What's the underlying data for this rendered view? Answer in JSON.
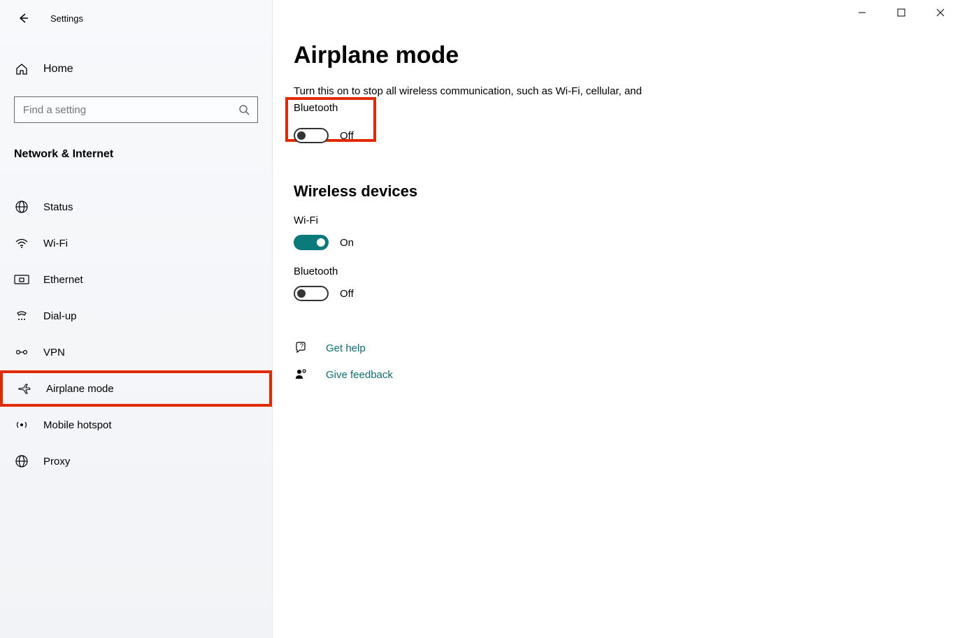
{
  "window": {
    "title": "Settings"
  },
  "sidebar": {
    "home_label": "Home",
    "search_placeholder": "Find a setting",
    "section_header": "Network & Internet",
    "items": [
      {
        "label": "Status",
        "icon": "status-icon"
      },
      {
        "label": "Wi-Fi",
        "icon": "wifi-icon"
      },
      {
        "label": "Ethernet",
        "icon": "ethernet-icon"
      },
      {
        "label": "Dial-up",
        "icon": "dialup-icon"
      },
      {
        "label": "VPN",
        "icon": "vpn-icon"
      },
      {
        "label": "Airplane mode",
        "icon": "airplane-icon",
        "highlighted": true
      },
      {
        "label": "Mobile hotspot",
        "icon": "hotspot-icon"
      },
      {
        "label": "Proxy",
        "icon": "proxy-icon"
      }
    ]
  },
  "main": {
    "title": "Airplane mode",
    "description": "Turn this on to stop all wireless communication, such as Wi-Fi, cellular, and Bluetooth",
    "airplane_toggle": {
      "state": "off",
      "label": "Off",
      "highlighted": true
    },
    "wireless_heading": "Wireless devices",
    "devices": [
      {
        "name": "Wi-Fi",
        "state": "on",
        "label": "On"
      },
      {
        "name": "Bluetooth",
        "state": "off",
        "label": "Off"
      }
    ],
    "help_links": [
      {
        "label": "Get help",
        "icon": "help-icon"
      },
      {
        "label": "Give feedback",
        "icon": "feedback-icon"
      }
    ]
  }
}
